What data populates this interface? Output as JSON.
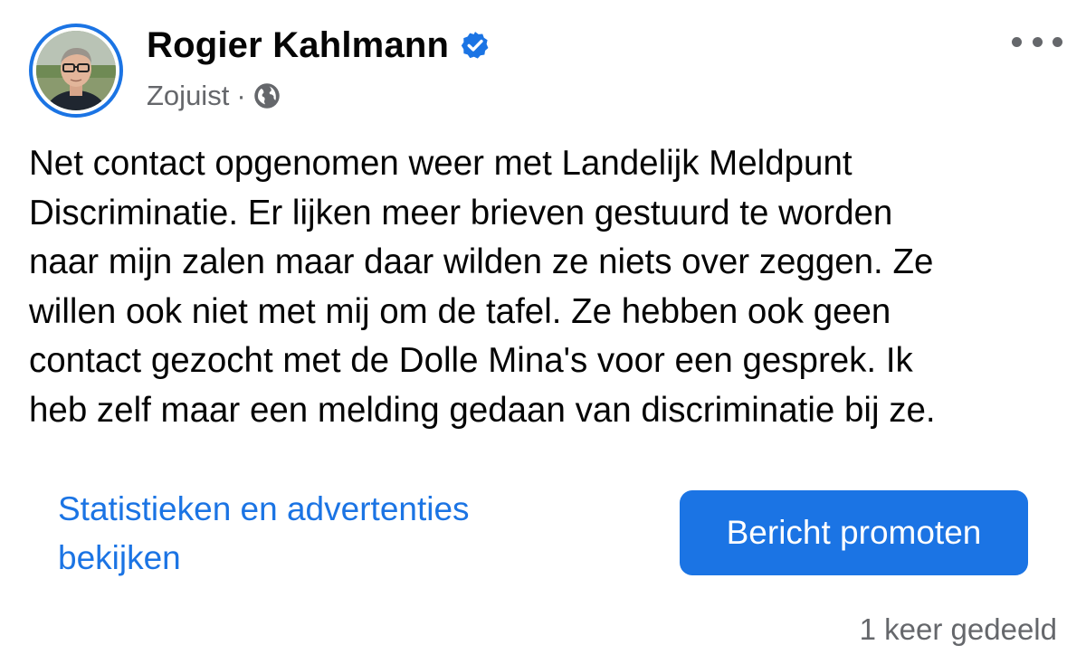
{
  "author": {
    "name": "Rogier Kahlmann",
    "verified": true,
    "avatar": "profile-photo"
  },
  "meta": {
    "timestamp": "Zojuist",
    "separator": "·",
    "audience_icon": "globe-icon"
  },
  "post": {
    "lines": [
      "Net contact opgenomen weer met Landelijk Meldpunt",
      "Discriminatie. Er lijken meer brieven gestuurd te worden",
      "naar mijn zalen maar daar wilden ze niets over zeggen. Ze",
      "willen ook niet met mij om de tafel. Ze hebben ook geen",
      "contact gezocht met de Dolle Mina's voor een gesprek. Ik",
      "heb zelf maar een melding gedaan van discriminatie bij ze."
    ]
  },
  "actions": {
    "insights_lines": [
      "Statistieken en advertenties",
      "bekijken"
    ],
    "promote_label": "Bericht promoten",
    "more_icon": "more-options-icon"
  },
  "footer": {
    "shares": "1 keer gedeeld"
  },
  "colors": {
    "accent": "#1b74e4",
    "secondary_text": "#65676b",
    "primary_text": "#050505"
  }
}
